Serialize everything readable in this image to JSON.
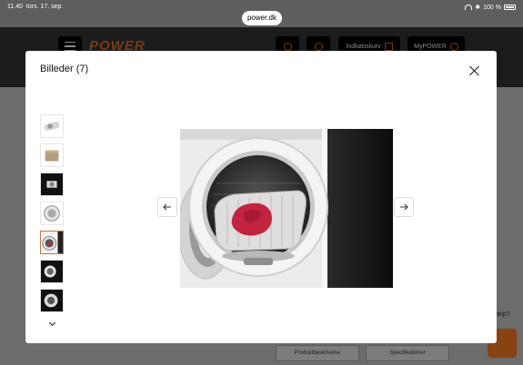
{
  "status_bar": {
    "time": "11.40",
    "date": "tors. 17. sep.",
    "battery": "100 %"
  },
  "browser": {
    "url": "power.dk"
  },
  "site": {
    "logo": "POWER",
    "header_buttons": {
      "basket": "Indkøbskurv",
      "account": "MyPOWER"
    },
    "bottom_tabs": [
      "Produktbeskrivelse",
      "Specifikationer"
    ],
    "help_label": "ælp?"
  },
  "modal": {
    "title": "Billeder (7)",
    "thumbnail_count": 7,
    "selected_index": 4,
    "colors": {
      "accent": "#b87b3e",
      "brand": "#ff6600"
    }
  }
}
